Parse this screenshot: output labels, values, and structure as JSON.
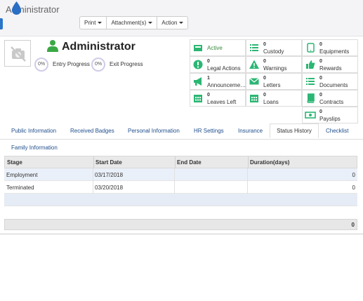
{
  "header": {
    "title": "Administrator"
  },
  "toolbar": {
    "print_label": "Print",
    "attachments_label": "Attachment(s)",
    "action_label": "Action"
  },
  "employee": {
    "name": "Administrator"
  },
  "progress": {
    "entry_value": "0%",
    "entry_label": "Entry Progress",
    "exit_value": "0%",
    "exit_label": "Exit Progress"
  },
  "stats": {
    "status": "Active",
    "custody": {
      "count": "0",
      "label": "Custody"
    },
    "equipments": {
      "count": "0",
      "label": "Equipments"
    },
    "legal_actions": {
      "count": "0",
      "label": "Legal Actions"
    },
    "warnings": {
      "count": "0",
      "label": "Warnings"
    },
    "rewards": {
      "count": "0",
      "label": "Rewards"
    },
    "announcements": {
      "count": "1",
      "label": "Announceme…"
    },
    "letters": {
      "count": "0",
      "label": "Letters"
    },
    "documents": {
      "count": "0",
      "label": "Documents"
    },
    "leaves_left": {
      "count": "0",
      "label": "Leaves Left"
    },
    "loans": {
      "count": "0",
      "label": "Loans"
    },
    "contracts": {
      "count": "0",
      "label": "Contracts"
    },
    "payslips": {
      "count": "0",
      "label": "Payslips"
    }
  },
  "tabs": [
    {
      "label": "Public Information"
    },
    {
      "label": "Received Badges"
    },
    {
      "label": "Personal Information"
    },
    {
      "label": "HR Settings"
    },
    {
      "label": "Insurance"
    },
    {
      "label": "Status History"
    },
    {
      "label": "Checklist"
    },
    {
      "label": "Family Information"
    }
  ],
  "active_tab": "Status History",
  "table": {
    "columns": [
      "Stage",
      "Start Date",
      "End Date",
      "Duration(days)"
    ],
    "rows": [
      {
        "stage": "Employment",
        "start": "03/17/2018",
        "end": "",
        "duration": "0"
      },
      {
        "stage": "Terminated",
        "start": "03/20/2018",
        "end": "",
        "duration": "0"
      }
    ],
    "total": "0"
  },
  "colors": {
    "accent_green": "#2bb673",
    "link_blue": "#1f4e8c",
    "row_alt": "#eaf0f9"
  }
}
